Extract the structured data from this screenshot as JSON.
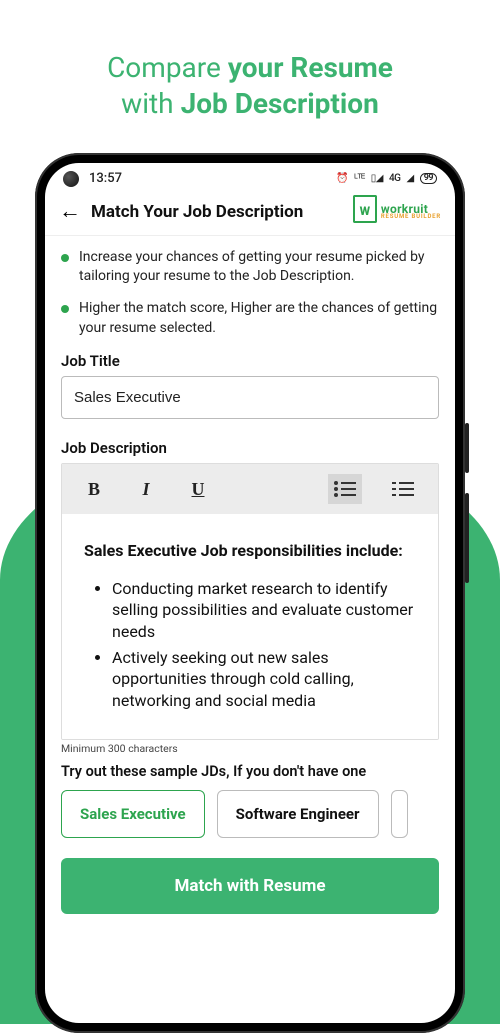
{
  "hero": {
    "line1a": "Compare ",
    "line1b": "your Resume",
    "line2a": "with ",
    "line2b": "Job Description"
  },
  "status": {
    "time": "13:57",
    "battery": "99"
  },
  "header": {
    "title": "Match Your Job Description",
    "brand_main": "workruit",
    "brand_sub": "RESUME BUILDER"
  },
  "tips": {
    "t1": "Increase your chances of getting your resume picked by tailoring your resume to the Job Description.",
    "t2": "Higher the match score, Higher are the chances of getting your resume selected."
  },
  "form": {
    "job_title_label": "Job Title",
    "job_title_value": "Sales Executive",
    "job_desc_label": "Job Description",
    "min_chars_hint": "Minimum 300 characters"
  },
  "jd": {
    "heading": "Sales Executive Job responsibilities include:",
    "bullets": [
      "Conducting market research to identify selling possibilities and evaluate customer needs",
      "Actively seeking out new sales opportunities through cold calling, networking and social media"
    ]
  },
  "samples": {
    "label": "Try out these sample JDs, If you don't have one",
    "items": [
      "Sales Executive",
      "Software Engineer"
    ],
    "active_index": 0
  },
  "cta": {
    "label": "Match with Resume"
  }
}
